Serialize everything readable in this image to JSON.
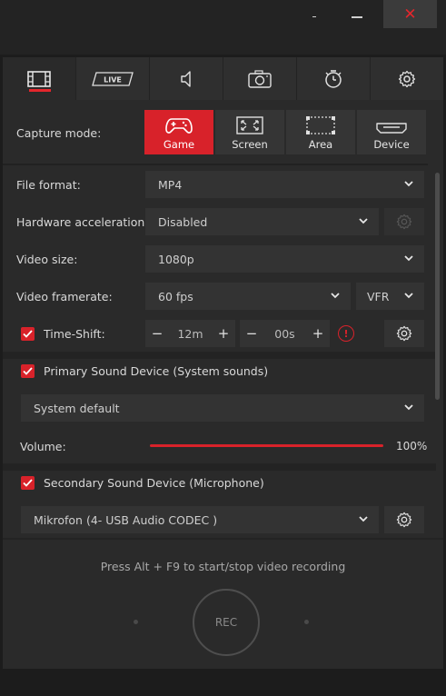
{
  "window": {
    "minimize_label": "-",
    "close_label": "✕"
  },
  "tabs": [
    {
      "icon": "video-film-icon",
      "active": true
    },
    {
      "icon": "live-icon",
      "label": "LIVE",
      "active": false
    },
    {
      "icon": "speaker-icon",
      "active": false
    },
    {
      "icon": "camera-icon",
      "active": false
    },
    {
      "icon": "timer-icon",
      "active": false
    },
    {
      "icon": "gear-icon",
      "active": false
    }
  ],
  "capture": {
    "label": "Capture mode:",
    "modes": [
      {
        "label": "Game",
        "icon": "gamepad-icon",
        "active": true
      },
      {
        "label": "Screen",
        "icon": "fullscreen-icon",
        "active": false
      },
      {
        "label": "Area",
        "icon": "area-select-icon",
        "active": false
      },
      {
        "label": "Device",
        "icon": "hdmi-icon",
        "active": false
      }
    ]
  },
  "settings": {
    "file_format": {
      "label": "File format:",
      "value": "MP4"
    },
    "hw_accel": {
      "label": "Hardware acceleration:",
      "value": "Disabled"
    },
    "video_size": {
      "label": "Video size:",
      "value": "1080p"
    },
    "framerate": {
      "label": "Video framerate:",
      "value": "60 fps",
      "mode": "VFR"
    },
    "timeshift": {
      "label": "Time-Shift:",
      "checked": true,
      "minutes": "12m",
      "seconds": "00s",
      "minus": "−",
      "plus": "+",
      "warning": "!"
    },
    "primary_sound": {
      "label": "Primary Sound Device (System sounds)",
      "checked": true,
      "device": "System default"
    },
    "volume": {
      "label": "Volume:",
      "value": "100%",
      "level": 1.0
    },
    "secondary_sound": {
      "label": "Secondary Sound Device (Microphone)",
      "checked": true,
      "device": "Mikrofon (4- USB Audio CODEC )"
    }
  },
  "footer": {
    "hint": "Press Alt + F9 to start/stop video recording",
    "rec_label": "REC"
  },
  "colors": {
    "accent": "#d8222a",
    "background": "#2a2a2a"
  }
}
